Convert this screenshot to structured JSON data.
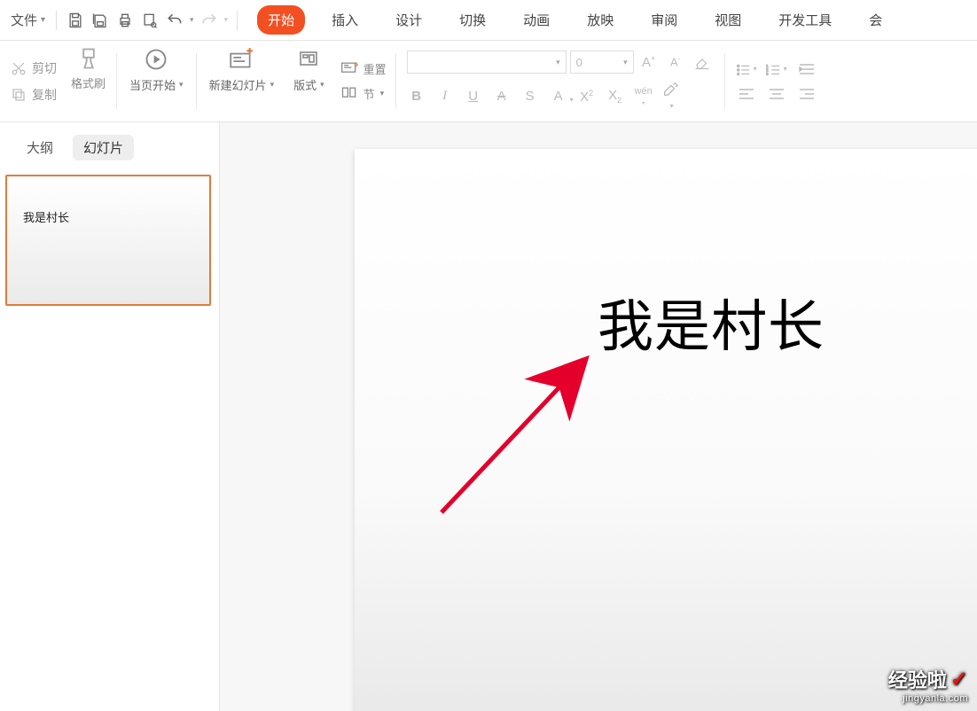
{
  "filemenu": {
    "label": "文件"
  },
  "tabs": {
    "start": "开始",
    "insert": "插入",
    "design": "设计",
    "transition": "切换",
    "animation": "动画",
    "slideshow": "放映",
    "review": "审阅",
    "view": "视图",
    "developer": "开发工具",
    "more": "会"
  },
  "clipboard": {
    "cut": "剪切",
    "copy": "复制",
    "format_painter": "格式刷"
  },
  "slides": {
    "from_current": "当页开始",
    "new_slide": "新建幻灯片",
    "layout": "版式",
    "section": "节",
    "reset": "重置"
  },
  "font": {
    "placeholder": "",
    "size_placeholder": "0"
  },
  "sidebar": {
    "outline": "大纲",
    "slides": "幻灯片",
    "thumb_text": "我是村长"
  },
  "slide": {
    "title": "我是村长"
  },
  "watermark": {
    "brand": "经验啦",
    "url": "jingyanla.com"
  }
}
